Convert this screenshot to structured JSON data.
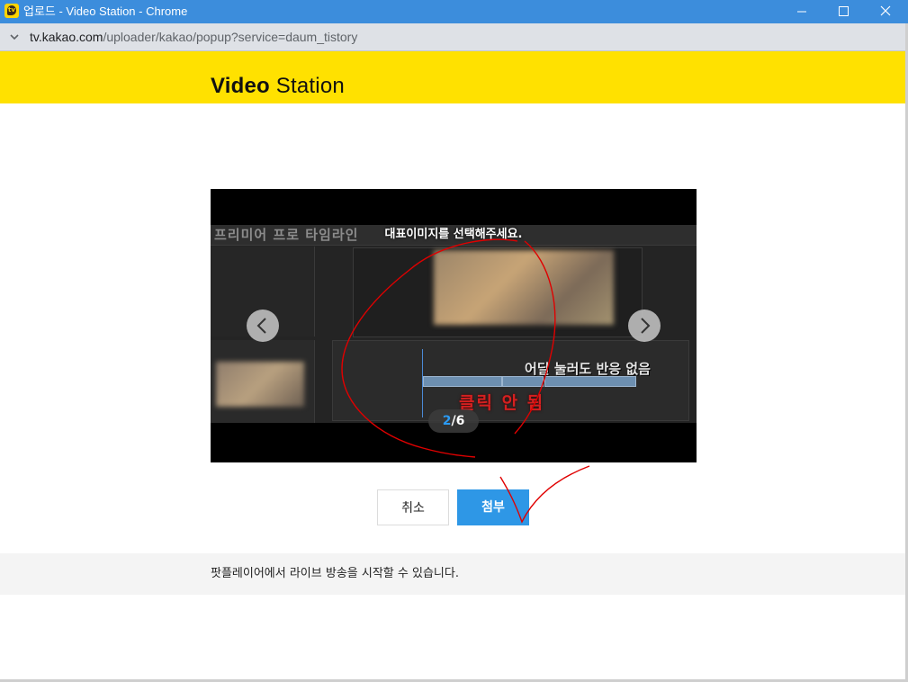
{
  "window": {
    "title": "업로드 - Video Station - Chrome",
    "app_icon": "kakaotv-icon",
    "controls": [
      "minimize-icon",
      "maximize-icon",
      "close-icon"
    ]
  },
  "addressbar": {
    "host": "tv.kakao.com",
    "path": "/uploader/kakao/popup?service=daum_tistory"
  },
  "header": {
    "brand_bold": "Video",
    "brand_light": " Station",
    "background_color": "#ffe100"
  },
  "preview": {
    "hint": "대표이미지를 선택해주세요.",
    "background_caption": "프리미어 프로 타임라인",
    "overlay_text": "어딜 눌러도 반응 없음",
    "overlay_red_text": "클릭 안 됨",
    "page_current": "2",
    "page_separator": "/",
    "page_total": "6",
    "prev_icon": "chevron-left-icon",
    "next_icon": "chevron-right-icon"
  },
  "actions": {
    "cancel_label": "취소",
    "attach_label": "첨부",
    "attach_color": "#2e97e6"
  },
  "notice": {
    "text": "팟플레이어에서 라이브 방송을 시작할 수 있습니다."
  }
}
